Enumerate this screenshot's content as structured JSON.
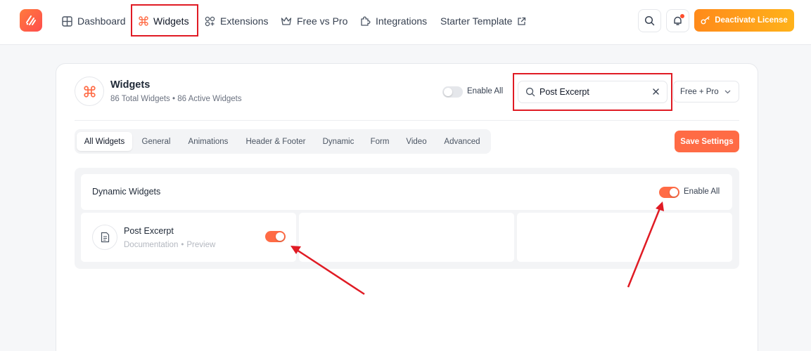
{
  "nav": {
    "items": [
      {
        "label": "Dashboard",
        "icon": "grid-icon"
      },
      {
        "label": "Widgets",
        "icon": "command-icon",
        "active": true
      },
      {
        "label": "Extensions",
        "icon": "extensions-icon"
      },
      {
        "label": "Free vs Pro",
        "icon": "crown-icon"
      },
      {
        "label": "Integrations",
        "icon": "puzzle-icon"
      },
      {
        "label": "Starter Template",
        "icon": "external-link-icon"
      }
    ],
    "license_button": "Deactivate License"
  },
  "header": {
    "title": "Widgets",
    "subtitle": "86 Total Widgets • 86 Active Widgets",
    "enable_all_label": "Enable All",
    "enable_all_on": false
  },
  "search": {
    "value": "Post Excerpt"
  },
  "filter": {
    "selected": "Free + Pro"
  },
  "tabs": [
    {
      "label": "All Widgets",
      "active": true
    },
    {
      "label": "General"
    },
    {
      "label": "Animations"
    },
    {
      "label": "Header & Footer"
    },
    {
      "label": "Dynamic"
    },
    {
      "label": "Form"
    },
    {
      "label": "Video"
    },
    {
      "label": "Advanced"
    }
  ],
  "save_label": "Save Settings",
  "section": {
    "title": "Dynamic Widgets",
    "enable_all_label": "Enable All",
    "enable_all_on": true
  },
  "widgets": [
    {
      "name": "Post Excerpt",
      "link_doc": "Documentation",
      "separator": "•",
      "link_preview": "Preview",
      "enabled": true
    }
  ],
  "colors": {
    "accent": "#ff6b45",
    "license_gradient_start": "#ff8a1a",
    "license_gradient_end": "#ffb21a",
    "annotation": "#e01b24"
  }
}
